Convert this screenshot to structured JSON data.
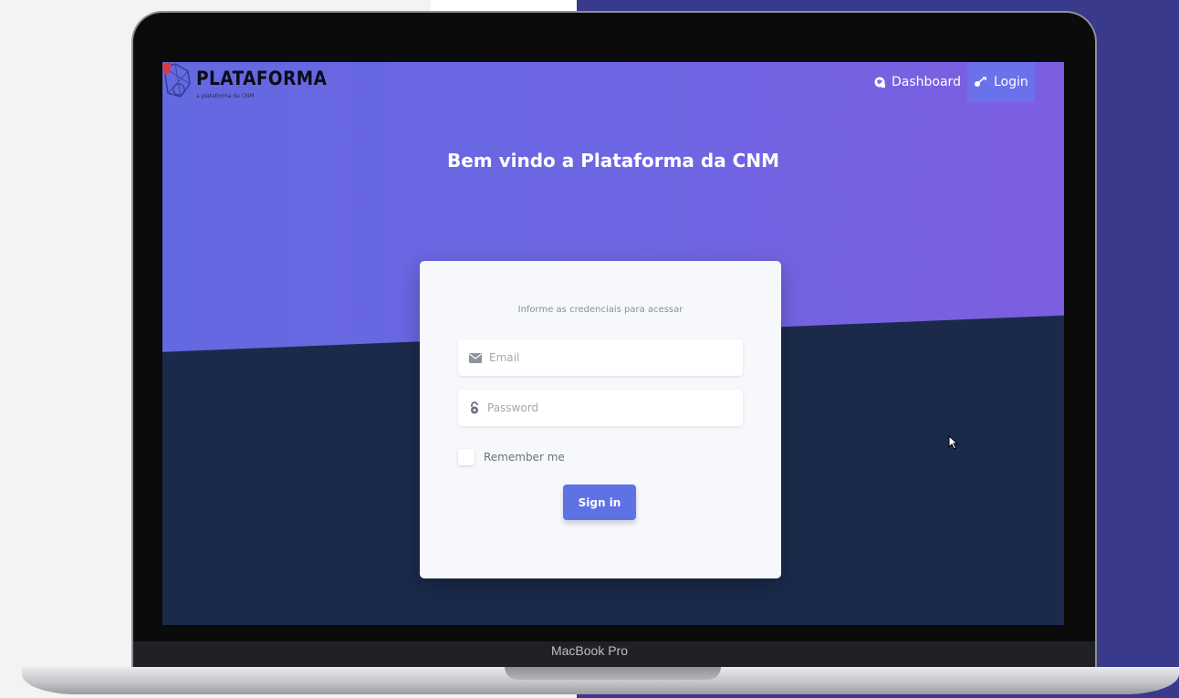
{
  "colors": {
    "gradient_start": "#6468e1",
    "gradient_end": "#7d5ee0",
    "screen_dark": "#1b2a4b",
    "card_bg": "#f6f8fb",
    "primary_button": "#5e72e4",
    "nav_active": "#6a71ea",
    "page_right_bg": "#3a3a8c"
  },
  "device": {
    "label": "MacBook Pro"
  },
  "header": {
    "brand_title": "PLATAFORMA",
    "brand_tagline": "a plataforma da CNM",
    "nav": [
      {
        "label": "Dashboard",
        "icon": "dashboard-globe-icon"
      },
      {
        "label": "Login",
        "icon": "key-icon",
        "active": true
      }
    ]
  },
  "main": {
    "heading": "Bem vindo a Plataforma da CNM"
  },
  "login_form": {
    "subtitle": "Informe as credenciais para acessar",
    "email": {
      "placeholder": "Email",
      "value": "",
      "icon": "envelope-icon"
    },
    "password": {
      "placeholder": "Password",
      "value": "",
      "icon": "lock-icon"
    },
    "remember_label": "Remember me",
    "remember_checked": false,
    "submit_label": "Sign in"
  }
}
